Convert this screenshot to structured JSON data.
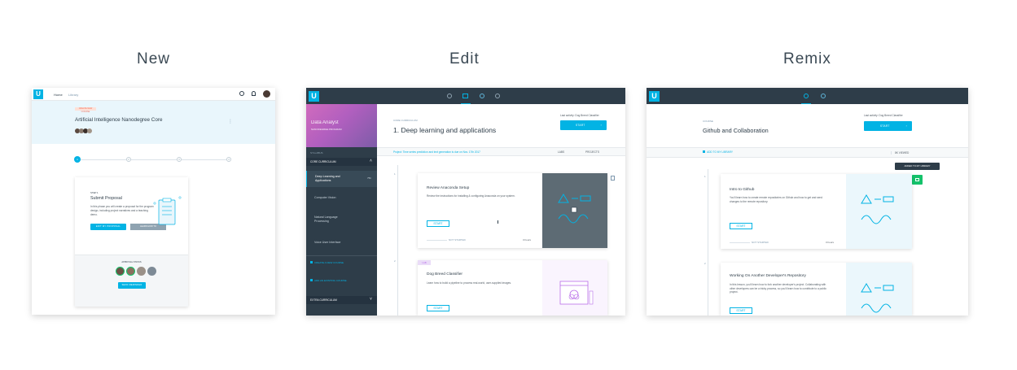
{
  "headings": {
    "new": "New",
    "edit": "Edit",
    "remix": "Remix"
  },
  "colors": {
    "accent": "#02b3e4",
    "dark": "#2e3d49",
    "green": "#15c26b",
    "lab_purple": "#b96ee8"
  },
  "new_panel": {
    "nav": {
      "home": "Home",
      "library": "Library"
    },
    "badge": "CREATE NEW COURSE",
    "course_title": "Artificial Intelligence Nanodegree Core",
    "steps": [
      "1",
      "2",
      "3",
      "4"
    ],
    "step_label": "STEP 1",
    "card_title": "Submit Proposal",
    "card_desc": "In this phase you will create a proposal for the program design, including project narratives and a teaching demo.",
    "primary_button": "EDIT MY PROPOSAL",
    "secondary_button": "LEARN HOW TO",
    "approval_label": "APPROVAL STATUS",
    "submit_button": "SEND REMINDER"
  },
  "edit_panel": {
    "hero_title": "Data Analyst",
    "hero_subtitle": "NANODEGREE PROGRAM",
    "syllabus_label": "SYLLABUS",
    "core_label": "CORE CURRICULUM",
    "sidebar_items": [
      {
        "label": "Deep Learning and Applications",
        "meta": "75h",
        "active": true
      },
      {
        "label": "Computer Vision",
        "meta": "",
        "active": false
      },
      {
        "label": "Natural Language Processing",
        "meta": "",
        "active": false
      },
      {
        "label": "Voice User Interface",
        "meta": "",
        "active": false
      }
    ],
    "create_course": "CREATE A NEW COURSE",
    "add_course": "ADD AN EXISTING COURSE",
    "extra_label": "EXTRA CURRICULUM",
    "section_label": "CORE CURRICULUM",
    "section_title": "1. Deep learning and applications",
    "last_activity": "Last activity: Dog Breed Classifier",
    "start_button": "START",
    "project_note": "Project: Time series prediction and text generation is due on Nov. 17th 2017",
    "labs_tab": "LABS",
    "projects_tab": "PROJECTS",
    "lessons": [
      {
        "num": "1",
        "title": "Review Anaconda Setup",
        "desc": "Review the instructions for installing & configuring Anaconda on your system.",
        "status": "NOT STARTED",
        "time": "3 hours",
        "button": "START"
      },
      {
        "num": "2",
        "tag": "LAB",
        "title": "Dog Breed Classifier",
        "desc": "Learn how to build a pipeline to process real-world, user-supplied images.",
        "button": "START"
      }
    ]
  },
  "remix_panel": {
    "course_label": "COURSE",
    "course_title": "Github and Collaboration",
    "last_activity": "Last activity: Dog Breed Classifier",
    "start_button": "START",
    "add_to_library": "ADD TO MY LIBRARY",
    "views": "8K VIEWED",
    "tooltip": "ADDED TO MY LIBRARY",
    "lessons": [
      {
        "num": "1",
        "title": "Intro to Github",
        "desc": "You'll learn how to create remote repositories on Github and how to get and send changes to the remote repository.",
        "button": "START",
        "status": "NOT STARTED",
        "time": "3 hours"
      },
      {
        "num": "2",
        "title": "Working On Another Developer's Repository",
        "desc": "In this lesson, you'll learn how to fork another developer's project. Collaborating with other developers can be a tricky process, so you'll learn how to contribute to a public project.",
        "button": "START"
      }
    ]
  }
}
